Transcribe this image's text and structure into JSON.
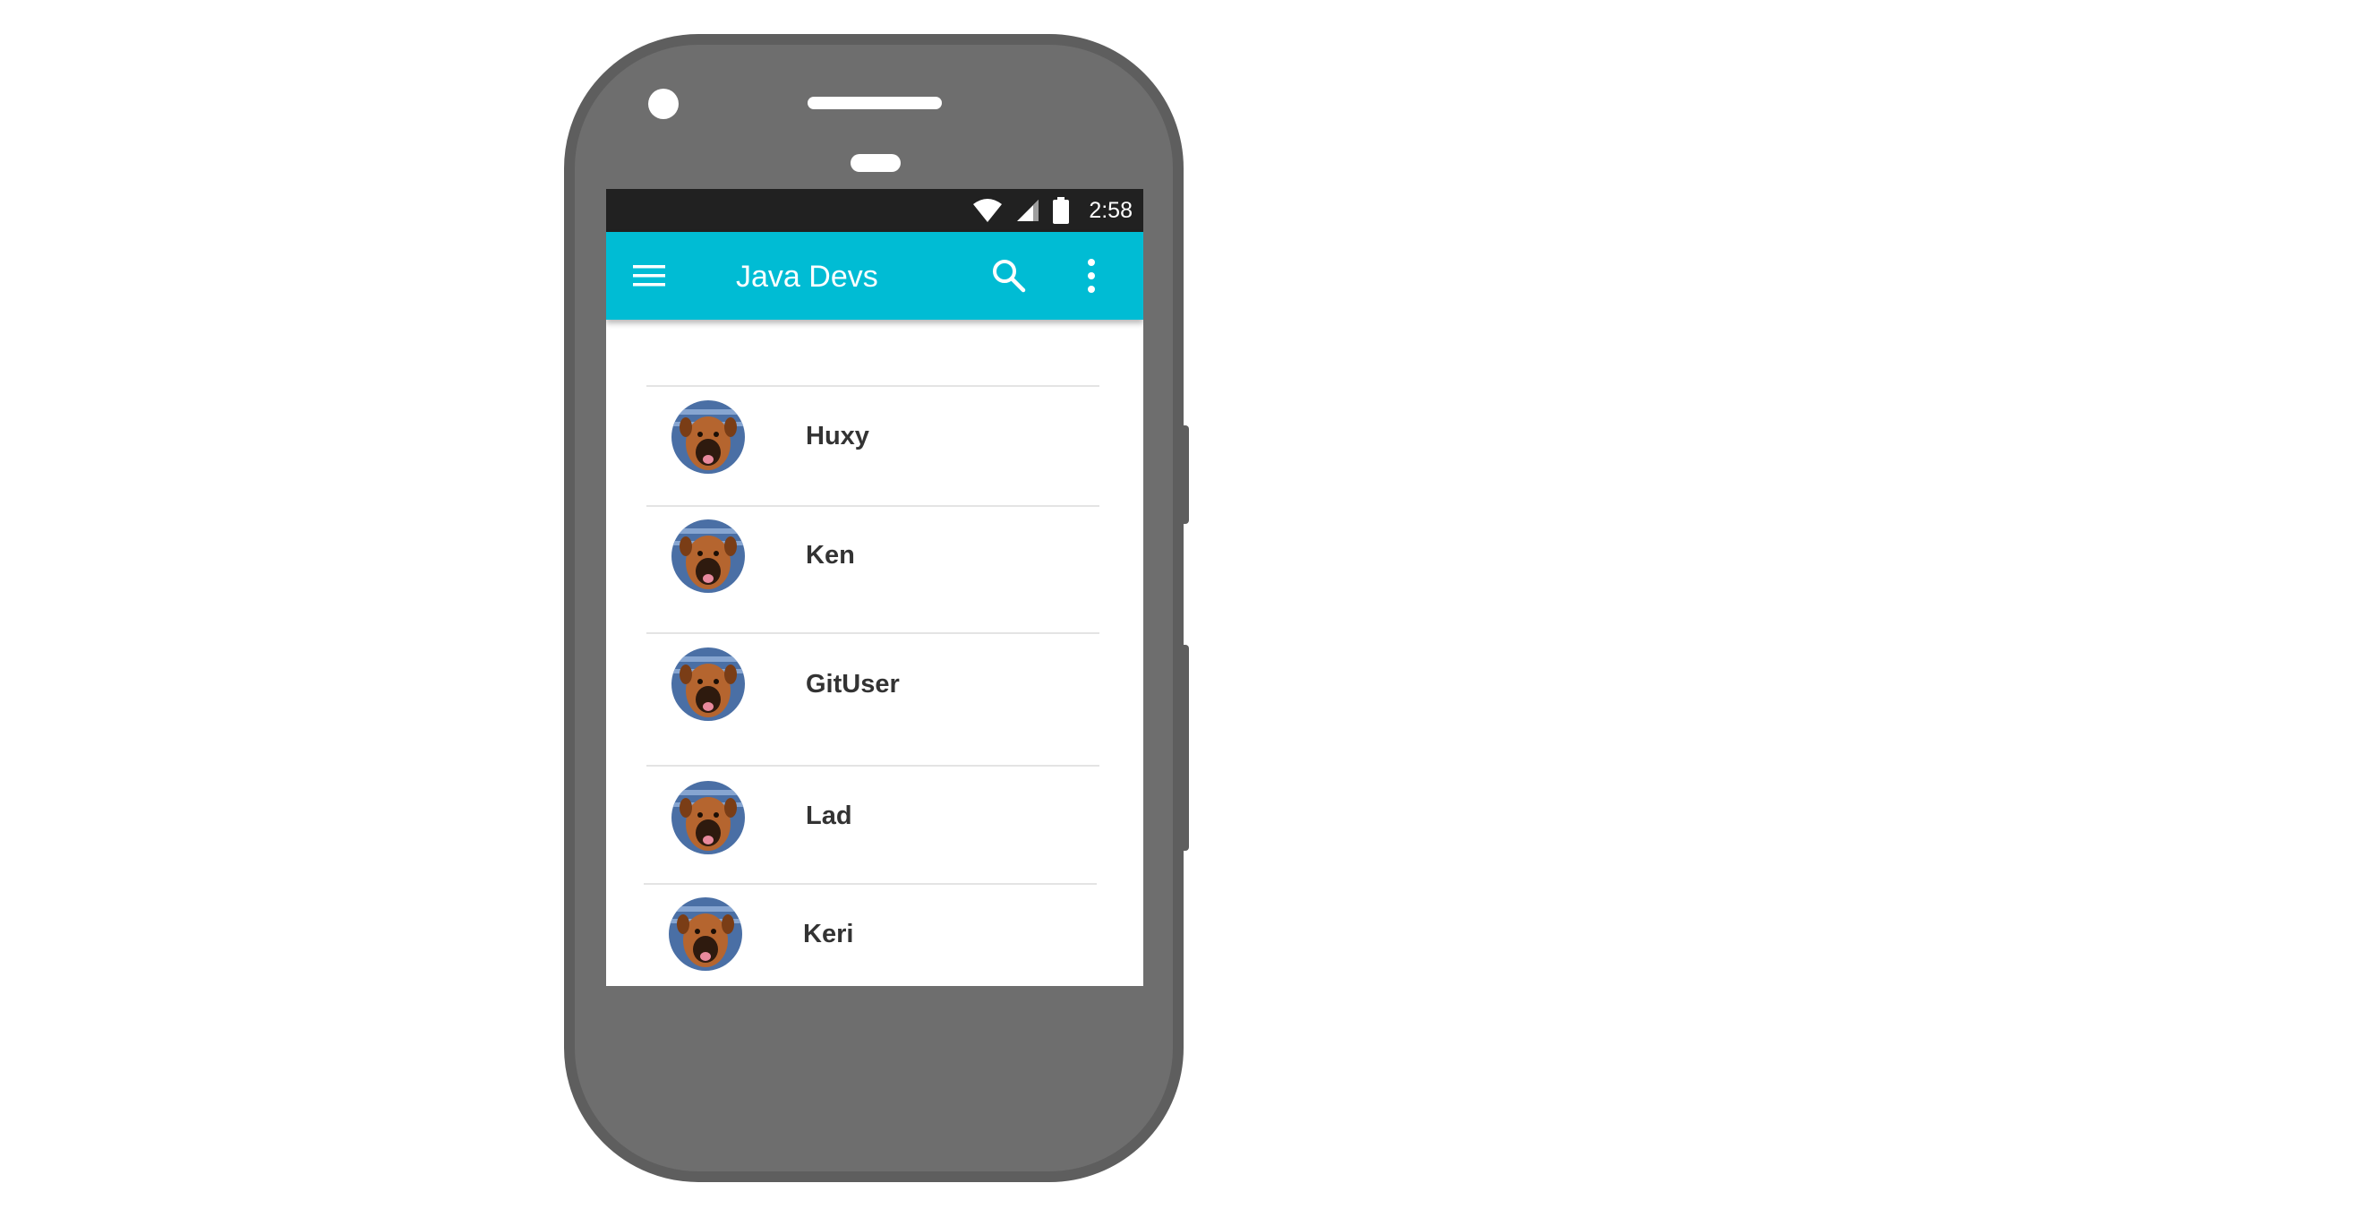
{
  "status_bar": {
    "time": "2:58",
    "icons": [
      "wifi-icon",
      "cell-signal-icon",
      "battery-icon"
    ]
  },
  "app_bar": {
    "title": "Java Devs",
    "icons": [
      "menu-icon",
      "search-icon",
      "more-vert-icon"
    ],
    "color": "#00bcd4"
  },
  "developers": [
    {
      "name": "Huxy",
      "avatar": "dog-avatar"
    },
    {
      "name": "Ken",
      "avatar": "dog-avatar"
    },
    {
      "name": "GitUser",
      "avatar": "dog-avatar"
    },
    {
      "name": "Lad",
      "avatar": "dog-avatar"
    },
    {
      "name": "Keri",
      "avatar": "dog-avatar"
    }
  ],
  "colors": {
    "phone_body": "#6e6e6e",
    "status_bar": "#212121",
    "app_bar": "#00bcd4",
    "divider": "#e4e4e4",
    "name_text": "#333333"
  }
}
